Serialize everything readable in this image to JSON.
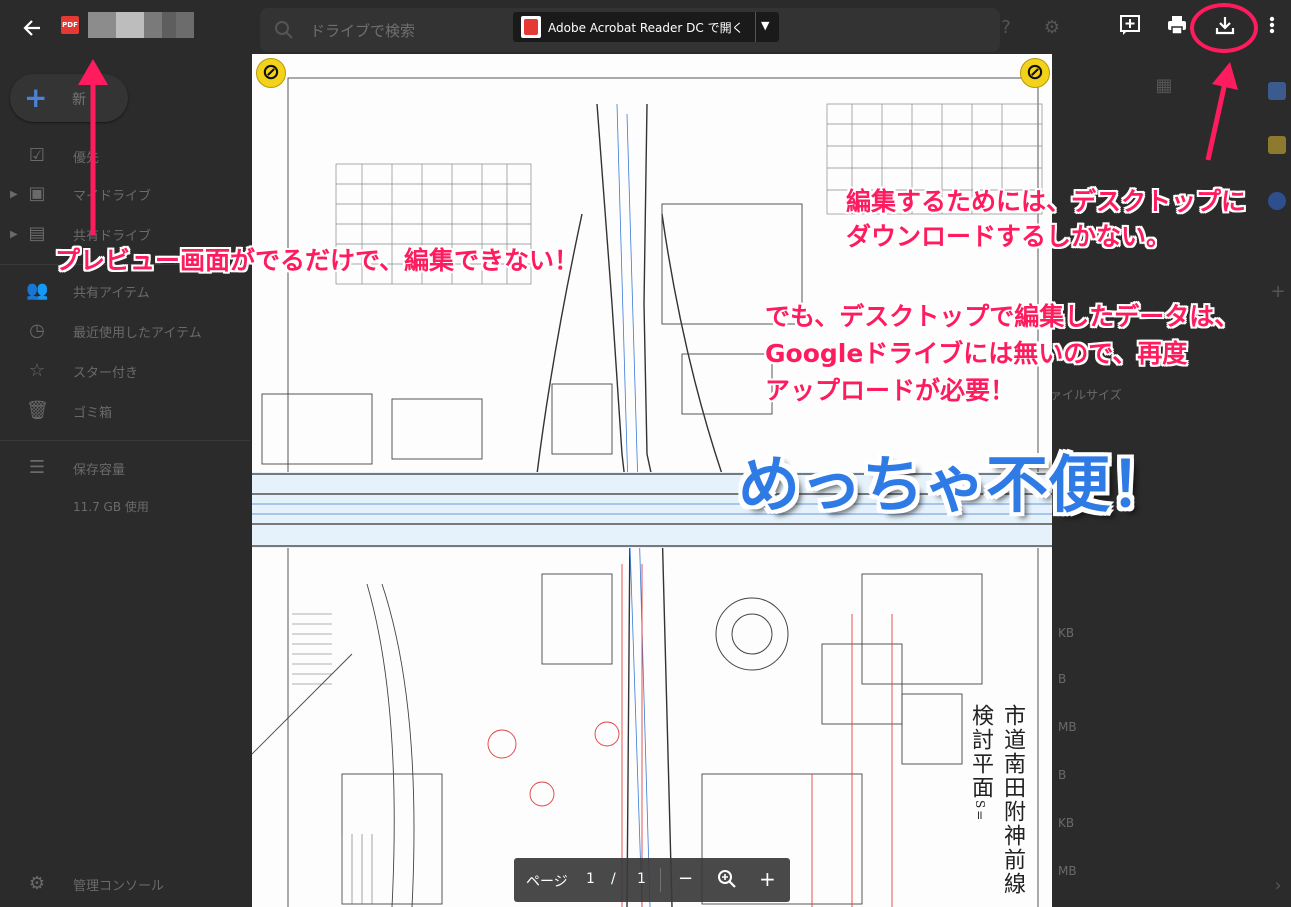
{
  "topbar": {
    "back_icon": "arrow-left-icon",
    "pdf_badge": "PDF",
    "open_with_label": "Adobe Acrobat Reader DC で開く",
    "icons": [
      "add-comment-icon",
      "print-icon",
      "download-icon",
      "more-vert-icon"
    ]
  },
  "drive": {
    "search_placeholder": "ドライブで検索",
    "new_label": "新",
    "nav_items": [
      {
        "label": "優先",
        "icon": "check-circle-icon"
      },
      {
        "label": "マイドライブ",
        "icon": "drive-icon"
      },
      {
        "label": "共有ドライブ",
        "icon": "shared-drive-icon"
      },
      {
        "label": "共有アイテム",
        "icon": "people-icon"
      },
      {
        "label": "最近使用したアイテム",
        "icon": "clock-icon"
      },
      {
        "label": "スター付き",
        "icon": "star-icon"
      },
      {
        "label": "ゴミ箱",
        "icon": "trash-icon"
      },
      {
        "label": "保存容量",
        "icon": "storage-icon"
      },
      {
        "label": "管理コンソール",
        "icon": "admin-icon"
      }
    ],
    "storage_used": "11.7 GB 使用",
    "right_column_header": "ァイルサイズ",
    "right_column_values": [
      "KB",
      "B",
      "MB",
      "B",
      "KB",
      "MB"
    ]
  },
  "document": {
    "vertical_title": "市道南田附神前線検討平面",
    "vertical_title_suffix": "S="
  },
  "page_toolbar": {
    "page_label": "ページ",
    "current_page": "1",
    "separator": "/",
    "total_pages": "1",
    "zoom_out": "−",
    "zoom_in": "+"
  },
  "annotations": {
    "note1": "プレビュー画面がでるだけで、編集できない！",
    "note2_line1": "編集するためには、デスクトップに",
    "note2_line2": "ダウンロードするしかない。",
    "note3_line1": "でも、デスクトップで編集したデータは、",
    "note3_line2": "Googleドライブには無いので、再度",
    "note3_line3": "アップロードが必要！",
    "big": "めっちゃ不便！",
    "highlight_color": "#ff1c5e",
    "big_color": "#2f7be6"
  }
}
